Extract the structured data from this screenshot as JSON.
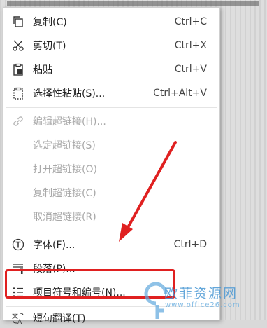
{
  "context_menu": {
    "items": [
      {
        "label": "复制(C)",
        "shortcut": "Ctrl+C",
        "icon": "copy-icon",
        "enabled": true
      },
      {
        "label": "剪切(T)",
        "shortcut": "Ctrl+X",
        "icon": "scissors-icon",
        "enabled": true
      },
      {
        "label": "粘贴",
        "shortcut": "Ctrl+V",
        "icon": "clipboard-paste-icon",
        "enabled": true
      },
      {
        "label": "选择性粘贴(S)...",
        "shortcut": "Ctrl+Alt+V",
        "icon": "paste-special-icon",
        "enabled": true
      },
      {
        "label": "编辑超链接(H)...",
        "shortcut": "",
        "icon": "hyperlink-icon",
        "enabled": false
      },
      {
        "label": "选定超链接(S)",
        "shortcut": "",
        "icon": "",
        "enabled": false
      },
      {
        "label": "打开超链接(O)",
        "shortcut": "",
        "icon": "",
        "enabled": false
      },
      {
        "label": "复制超链接(C)",
        "shortcut": "",
        "icon": "",
        "enabled": false
      },
      {
        "label": "取消超链接(R)",
        "shortcut": "",
        "icon": "",
        "enabled": false
      },
      {
        "label": "字体(F)...",
        "shortcut": "Ctrl+D",
        "icon": "font-icon",
        "enabled": true
      },
      {
        "label": "段落(P)...",
        "shortcut": "",
        "icon": "paragraph-icon",
        "enabled": true
      },
      {
        "label": "项目符号和编号(N)...",
        "shortcut": "",
        "icon": "bullet-list-icon",
        "enabled": true,
        "highlighted": true
      },
      {
        "label": "短句翻译(T)",
        "shortcut": "",
        "icon": "translate-icon",
        "enabled": true
      }
    ]
  },
  "annotation": {
    "highlight_color": "#e02020",
    "arrow_color": "#e02020"
  },
  "watermark": {
    "text": "欧菲资源网",
    "url": "www.office26.com"
  }
}
